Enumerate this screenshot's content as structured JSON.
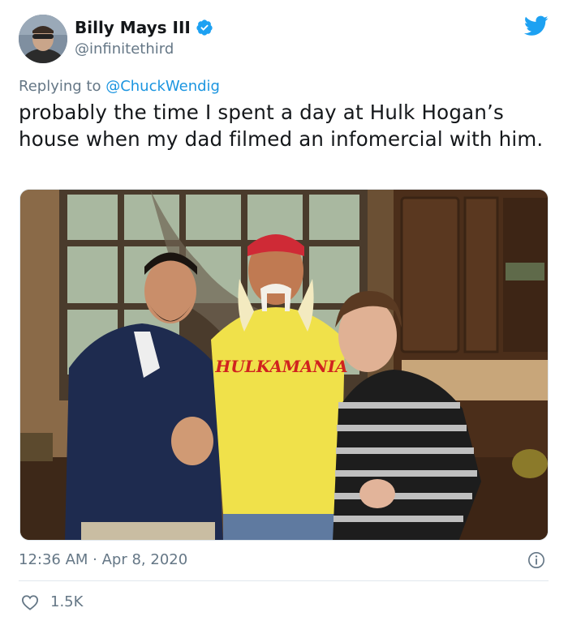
{
  "author": {
    "display_name": "Billy Mays III",
    "handle": "@infinitethird",
    "verified": true
  },
  "reply": {
    "prefix": "Replying to ",
    "mention": "@ChuckWendig"
  },
  "tweet_text": "probably the time I spent a day at Hulk Hogan’s house when my dad filmed an infomercial with him.",
  "photo": {
    "shirt_text": "HULKAMANIA"
  },
  "meta": {
    "timestamp": "12:36 AM · Apr 8, 2020"
  },
  "stats": {
    "likes": "1.5K"
  },
  "colors": {
    "accent": "#1da1f2",
    "text": "#14171a",
    "secondary": "#657786",
    "divider": "#e1e8ed"
  },
  "icons": [
    "verified-badge-icon",
    "twitter-bird-icon",
    "info-icon",
    "heart-icon"
  ]
}
